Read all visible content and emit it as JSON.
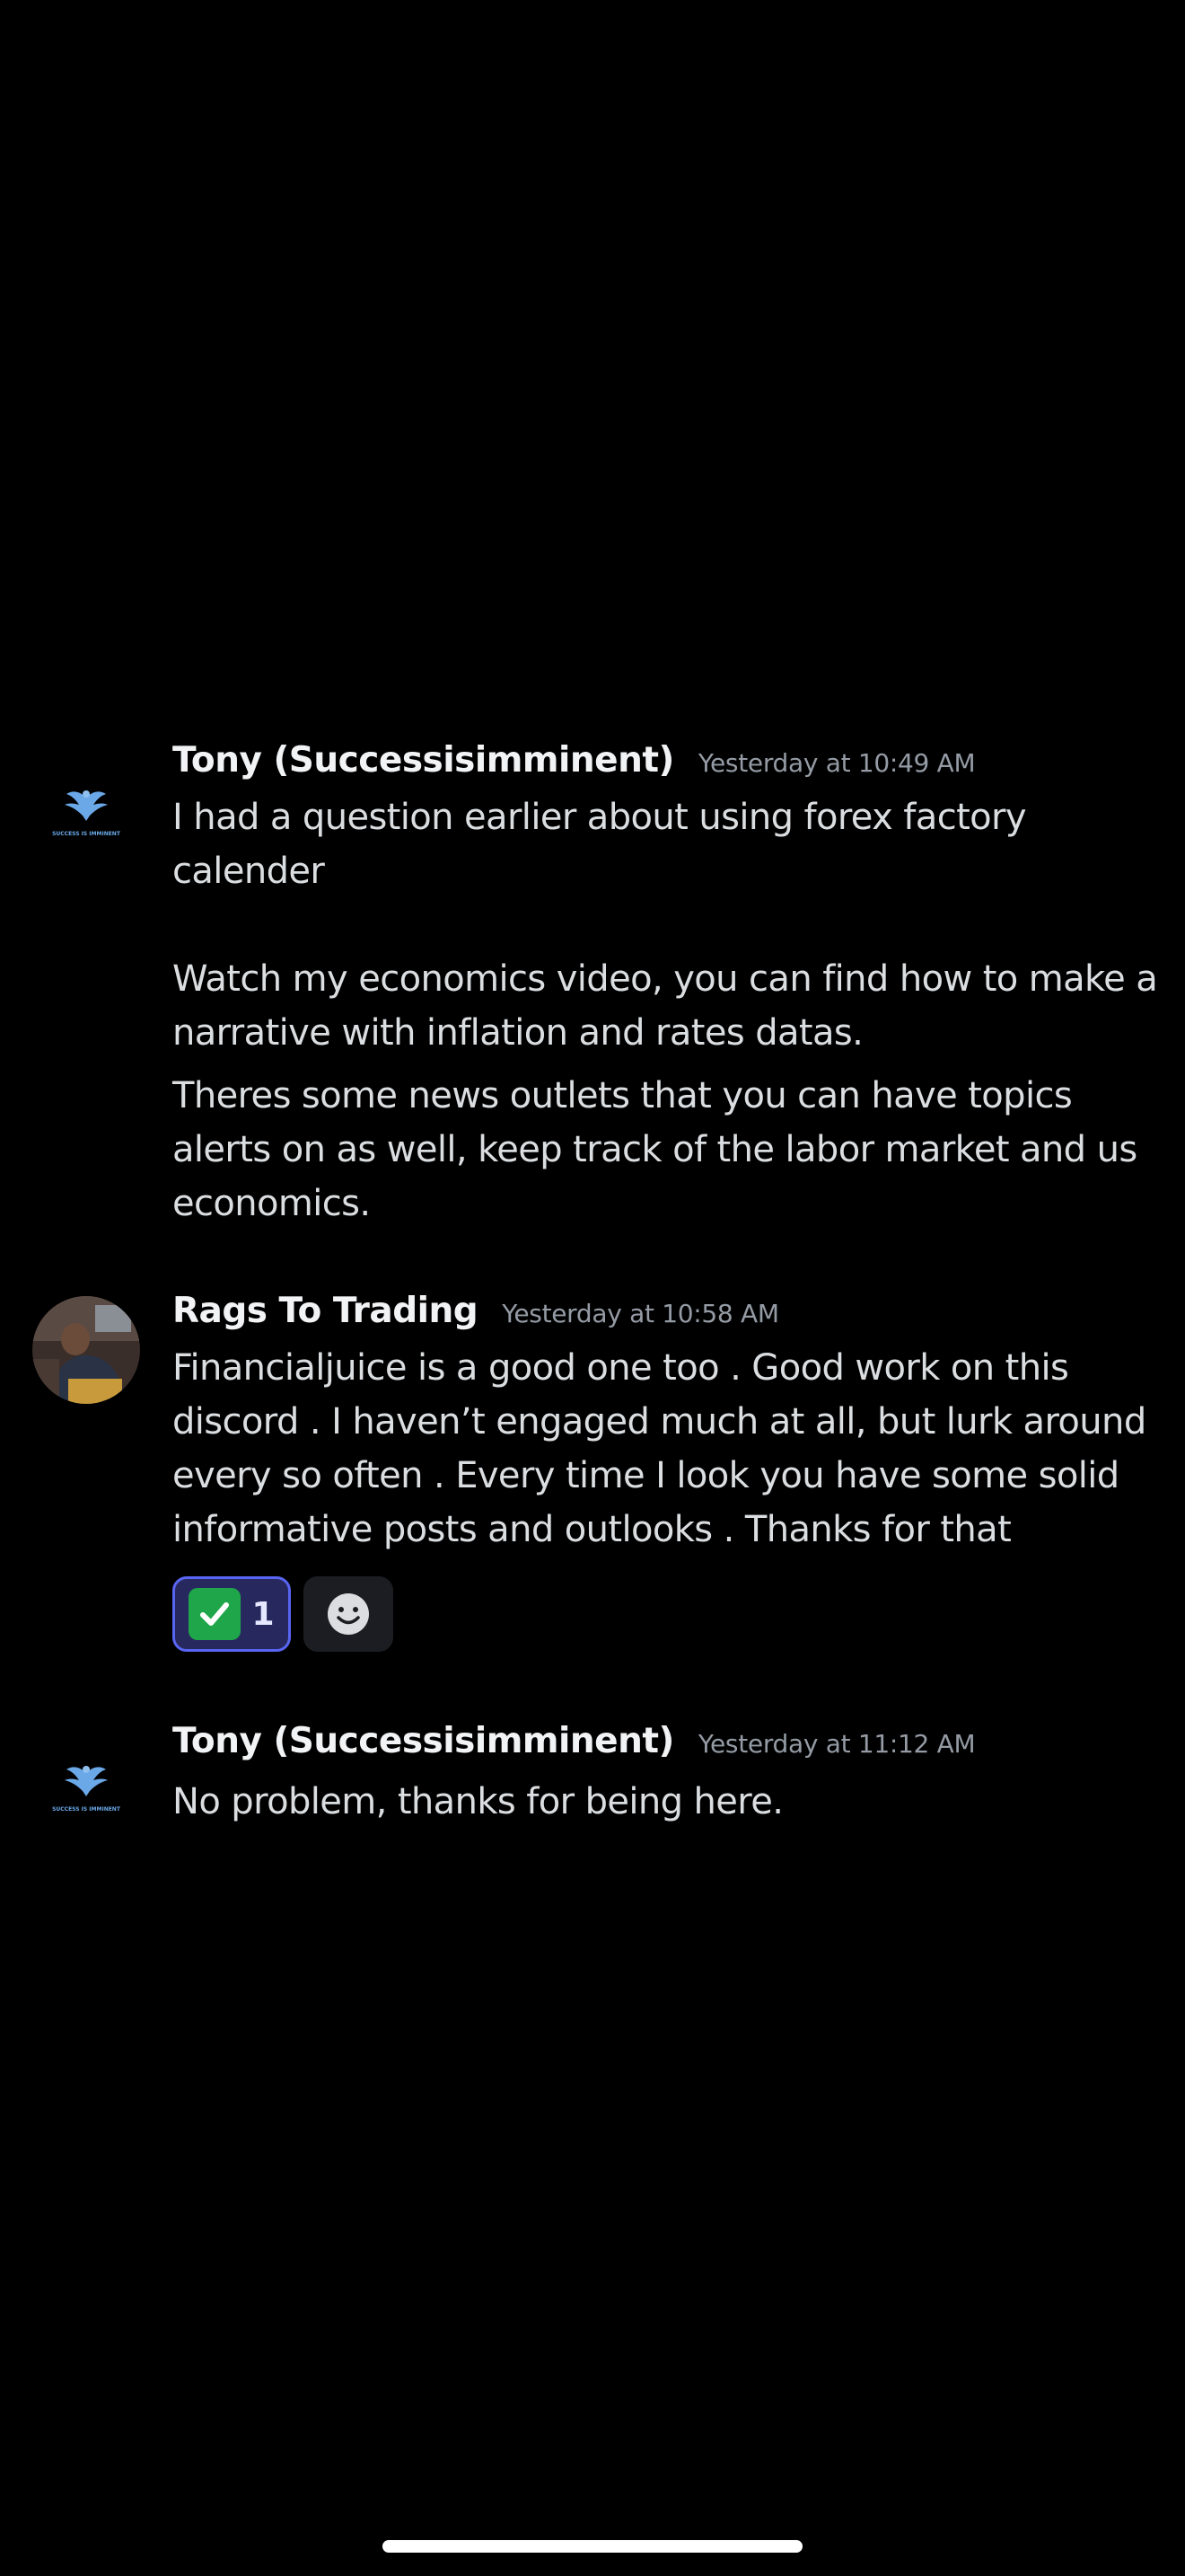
{
  "messages": [
    {
      "author": "Tony (Successisimminent)",
      "timestamp": "Yesterday at 10:49 AM",
      "avatar_icon": "eagle-logo-icon",
      "avatar_caption": "SUCCESS IS IMMINENT",
      "paragraphs": [
        "I had a question earlier about using forex factory calender",
        "Watch my economics video, you can find how to make a narrative with inflation and rates datas.",
        "Theres some news outlets that you can have topics alerts on as well, keep track of the labor market and us economics."
      ]
    },
    {
      "author": "Rags To Trading",
      "timestamp": "Yesterday at 10:58 AM",
      "avatar_icon": "user-photo-avatar",
      "paragraphs": [
        "Financialjuice is a good one too . Good work on this discord . I haven’t engaged much at all, but lurk around every so often . Every time I look you have some solid informative posts and outlooks . Thanks for that"
      ],
      "reactions": [
        {
          "emoji": "white-check-mark-icon",
          "count": "1",
          "selected": true
        }
      ],
      "add_reaction_icon": "smiley-icon"
    },
    {
      "author": "Tony (Successisimminent)",
      "timestamp": "Yesterday at 11:12 AM",
      "avatar_icon": "eagle-logo-icon",
      "avatar_caption": "SUCCESS IS IMMINENT",
      "paragraphs": [
        "No problem, thanks for being here."
      ]
    }
  ],
  "colors": {
    "background": "#000000",
    "author": "#f2f3f5",
    "timestamp": "#949ba4",
    "text": "#dbdee1",
    "reaction_selected_bg": "#27295e",
    "reaction_selected_border": "#5865f2"
  }
}
